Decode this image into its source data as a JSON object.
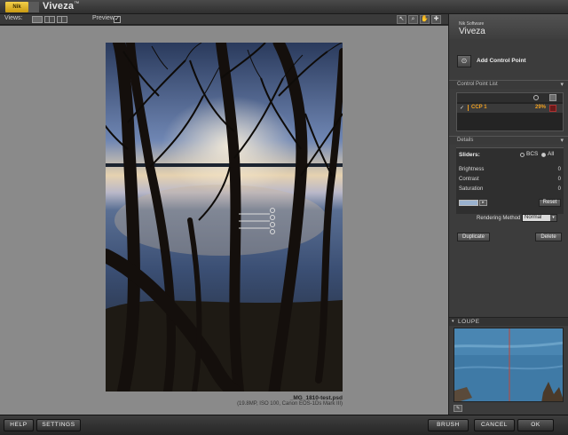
{
  "app": {
    "title": "Viveza",
    "trademark": "™",
    "logo_text": "Nik"
  },
  "toolbar": {
    "views_label": "Views:",
    "preview_label": "Preview:",
    "preview_checked": "✓"
  },
  "image": {
    "file_name": "_MG_1810-test.psd",
    "file_meta": "(19.8MP, ISO 100, Canon EOS-1Ds Mark III)"
  },
  "panel": {
    "brand_small": "Nik Software",
    "brand_big": "Viveza",
    "add_control_point": "Add Control Point",
    "control_point_list_label": "Control Point List",
    "control_points": [
      {
        "check": "✓",
        "name": "CCP 1",
        "percent": "29%"
      }
    ],
    "details_label": "Details",
    "sliders_label": "Sliders:",
    "bcs_label": "BCS",
    "all_label": "All",
    "adjustments": [
      {
        "label": "Brightness",
        "value": "0"
      },
      {
        "label": "Contrast",
        "value": "0"
      },
      {
        "label": "Saturation",
        "value": "0"
      }
    ],
    "reset_label": "Reset",
    "rendering_method_label": "Rendering Method",
    "rendering_method_value": "Normal",
    "duplicate_label": "Duplicate",
    "delete_label": "Delete",
    "loupe_label": "LOUPE"
  },
  "bottom": {
    "help": "HELP",
    "settings": "SETTINGS",
    "brush": "BRUSH",
    "cancel": "CANCEL",
    "ok": "OK"
  }
}
